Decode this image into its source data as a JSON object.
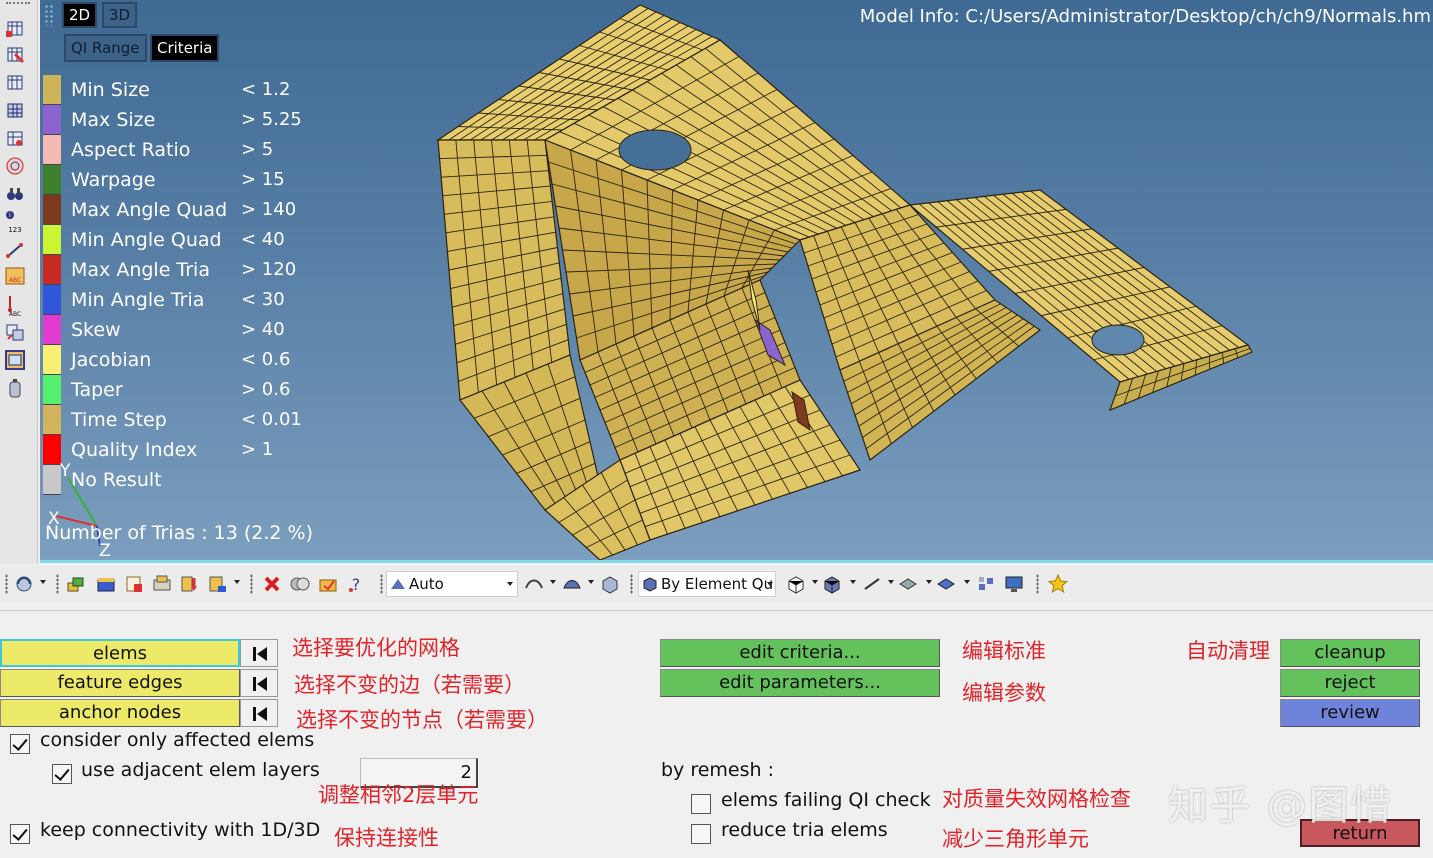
{
  "viewport": {
    "view_buttons": [
      "2D",
      "3D"
    ],
    "mode_tabs": [
      "QI Range",
      "Criteria"
    ],
    "model_info": "Model Info: C:/Users/Administrator/Desktop/ch/ch9/Normals.hm",
    "legend": [
      {
        "label": "Min Size",
        "value": "< 1.2",
        "color": "#cdb35a"
      },
      {
        "label": "Max Size",
        "value": "> 5.25",
        "color": "#8a63cf"
      },
      {
        "label": "Aspect Ratio",
        "value": "> 5",
        "color": "#f5b9b4"
      },
      {
        "label": "Warpage",
        "value": "> 15",
        "color": "#3d7f2b"
      },
      {
        "label": "Max Angle Quad",
        "value": "> 140",
        "color": "#7e3a1c"
      },
      {
        "label": "Min Angle Quad",
        "value": "< 40",
        "color": "#c9f532"
      },
      {
        "label": "Max Angle Tria",
        "value": "> 120",
        "color": "#c72a22"
      },
      {
        "label": "Min Angle Tria",
        "value": "< 30",
        "color": "#2f57d8"
      },
      {
        "label": "Skew",
        "value": "> 40",
        "color": "#e23bd2"
      },
      {
        "label": "Jacobian",
        "value": "< 0.6",
        "color": "#f7ef74"
      },
      {
        "label": "Taper",
        "value": "> 0.6",
        "color": "#57f06e"
      },
      {
        "label": "Time Step",
        "value": "< 0.01",
        "color": "#d2b45c"
      },
      {
        "label": "Quality Index",
        "value": "> 1",
        "color": "#ff0000"
      },
      {
        "label": "No Result",
        "value": "",
        "color": "#c8c8c8"
      }
    ],
    "trias_count": "Number of Trias : 13 (2.2 %)",
    "triad": {
      "x": "X",
      "y": "Y",
      "z": "Z"
    },
    "mesh_color": "#e3c767"
  },
  "toolbar": {
    "visualization_combo": "Auto",
    "color_by_combo": "By Element Qu"
  },
  "panel": {
    "selectors": [
      {
        "label": "elems",
        "note": "选择要优化的网格"
      },
      {
        "label": "feature edges",
        "note": "选择不变的边（若需要）"
      },
      {
        "label": "anchor nodes",
        "note": "选择不变的节点（若需要）"
      }
    ],
    "consider_only_affected": "consider only affected elems",
    "use_adjacent_layers": "use adjacent elem layers",
    "adjacent_layers_value": "2",
    "adjacent_note": "调整相邻2层单元",
    "keep_connectivity": "keep connectivity with 1D/3D",
    "keep_connectivity_note": "保持连接性",
    "edit_criteria": "edit criteria...",
    "edit_criteria_note": "编辑标准",
    "edit_parameters": "edit parameters...",
    "edit_parameters_note": "编辑参数",
    "by_remesh": "by remesh :",
    "elems_failing_qi": "elems failing QI check",
    "elems_failing_qi_note": "对质量失效网格检查",
    "reduce_tria": "reduce tria elems",
    "reduce_tria_note": "减少三角形单元",
    "auto_cleanup_note": "自动清理",
    "cleanup": "cleanup",
    "reject": "reject",
    "review": "review",
    "return": "return",
    "watermark": "知乎 @图惜"
  }
}
